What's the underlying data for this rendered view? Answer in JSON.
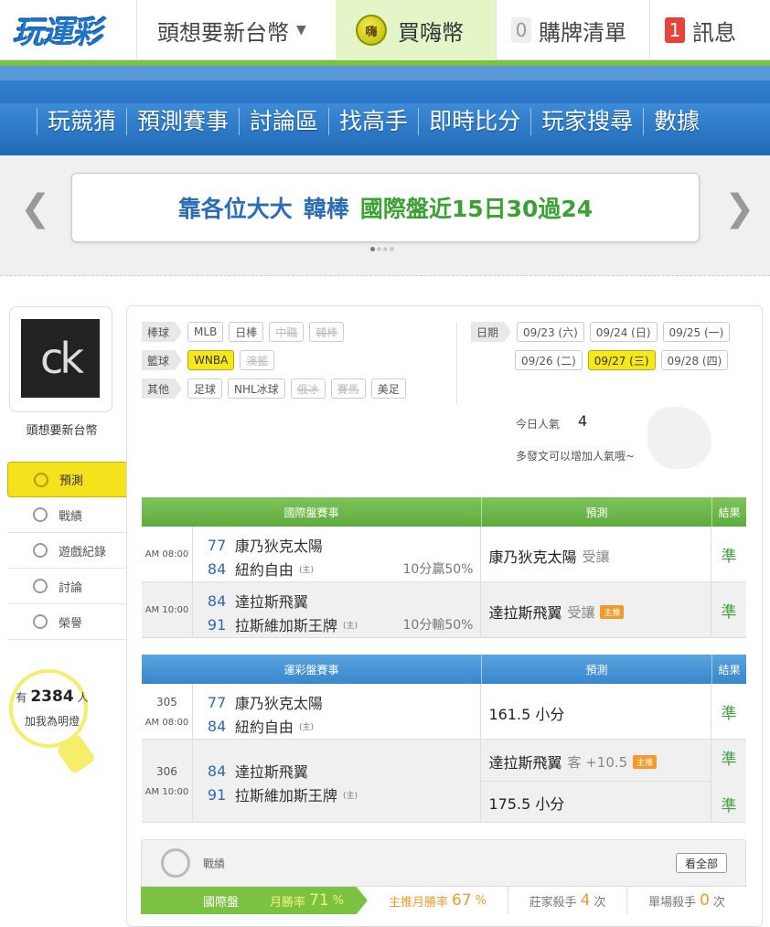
{
  "topbar": {
    "logo_text": "玩運彩",
    "username": "頭想要新台幣",
    "buy_coins": "買嗨幣",
    "coin_icon_text": "嗨",
    "cart_count": "0",
    "cart_label": "購牌清單",
    "msg_count": "1",
    "msg_label": "訊息"
  },
  "nav": [
    "玩競猜",
    "預測賽事",
    "討論區",
    "找高手",
    "即時比分",
    "玩家搜尋",
    "數據"
  ],
  "banner": {
    "part1": "靠各位大大",
    "part2": "韓棒",
    "part3": "國際盤近15日30過24"
  },
  "profile": {
    "avatar_text": "ck",
    "name": "頭想要新台幣"
  },
  "side_menu": [
    {
      "label": "預測",
      "active": true
    },
    {
      "label": "戰績",
      "active": false
    },
    {
      "label": "遊戲紀錄",
      "active": false
    },
    {
      "label": "討論",
      "active": false
    },
    {
      "label": "榮譽",
      "active": false
    }
  ],
  "fans": {
    "prefix": "有",
    "count": "2384",
    "suffix": "人",
    "sub": "加我為明燈"
  },
  "filters": {
    "baseball": {
      "label": "棒球",
      "tags": [
        "MLB",
        "日棒",
        "中職",
        "韓棒"
      ],
      "disabled": [
        2,
        3
      ]
    },
    "basketball": {
      "label": "籃球",
      "tags": [
        "WNBA",
        "澳籃"
      ],
      "selected": 0,
      "disabled": [
        1
      ]
    },
    "other": {
      "label": "其他",
      "tags": [
        "足球",
        "NHL冰球",
        "俄冰",
        "賽馬",
        "美足"
      ],
      "disabled": [
        2,
        3
      ]
    },
    "date_label": "日期",
    "dates_row1": [
      "09/23 (六)",
      "09/24 (日)",
      "09/25 (一)"
    ],
    "dates_row2": [
      "09/26 (二)",
      "09/27 (三)",
      "09/28 (四)"
    ],
    "selected_date": "09/27 (三)"
  },
  "popularity": {
    "label": "今日人氣",
    "value": "4",
    "sub": "多發文可以增加人氣哦~"
  },
  "intl_table": {
    "headers": [
      "國際盤賽事",
      "預測",
      "結果"
    ],
    "rows": [
      {
        "time": "AM 08:00",
        "away_no": "77",
        "away": "康乃狄克太陽",
        "home_no": "84",
        "home": "紐約自由",
        "home_tag": "(主)",
        "odds": "10分贏50%",
        "pred": "康乃狄克太陽",
        "pred_note": "受讓",
        "pred_tag": "",
        "result": "準"
      },
      {
        "time": "AM 10:00",
        "away_no": "84",
        "away": "達拉斯飛翼",
        "home_no": "91",
        "home": "拉斯維加斯王牌",
        "home_tag": "(主)",
        "odds": "10分輸50%",
        "pred": "達拉斯飛翼",
        "pred_note": "受讓",
        "pred_tag": "主推",
        "result": "準"
      }
    ]
  },
  "lottery_table": {
    "headers": [
      "運彩盤賽事",
      "預測",
      "結果"
    ],
    "rows": [
      {
        "game_no": "305",
        "time": "AM 08:00",
        "away_no": "77",
        "away": "康乃狄克太陽",
        "home_no": "84",
        "home": "紐約自由",
        "home_tag": "(主)",
        "preds": [
          {
            "text": "161.5 小分",
            "note": "",
            "tag": "",
            "result": "準"
          }
        ]
      },
      {
        "game_no": "306",
        "time": "AM 10:00",
        "away_no": "84",
        "away": "達拉斯飛翼",
        "home_no": "91",
        "home": "拉斯維加斯王牌",
        "home_tag": "(主)",
        "preds": [
          {
            "text": "達拉斯飛翼",
            "note": "客 +10.5",
            "tag": "主推",
            "result": "準"
          },
          {
            "text": "175.5 小分",
            "note": "",
            "tag": "",
            "result": "準"
          }
        ]
      }
    ]
  },
  "record": {
    "title": "戰績",
    "view_all": "看全部",
    "tab": "國際盤",
    "month_win_label": "月勝率",
    "month_win_value": "71",
    "month_win_unit": "%",
    "main_month_label": "主推月勝率",
    "main_month_value": "67",
    "main_month_unit": "%",
    "banker_label": "莊家殺手",
    "banker_value": "4",
    "banker_unit": "次",
    "single_label": "單場殺手",
    "single_value": "0",
    "single_unit": "次"
  },
  "colors": {
    "green": "#7cc242",
    "blue": "#2b76c4",
    "accent_yellow": "#f3e21c",
    "result_green": "#3aa33a",
    "badge_red": "#e8423c"
  }
}
